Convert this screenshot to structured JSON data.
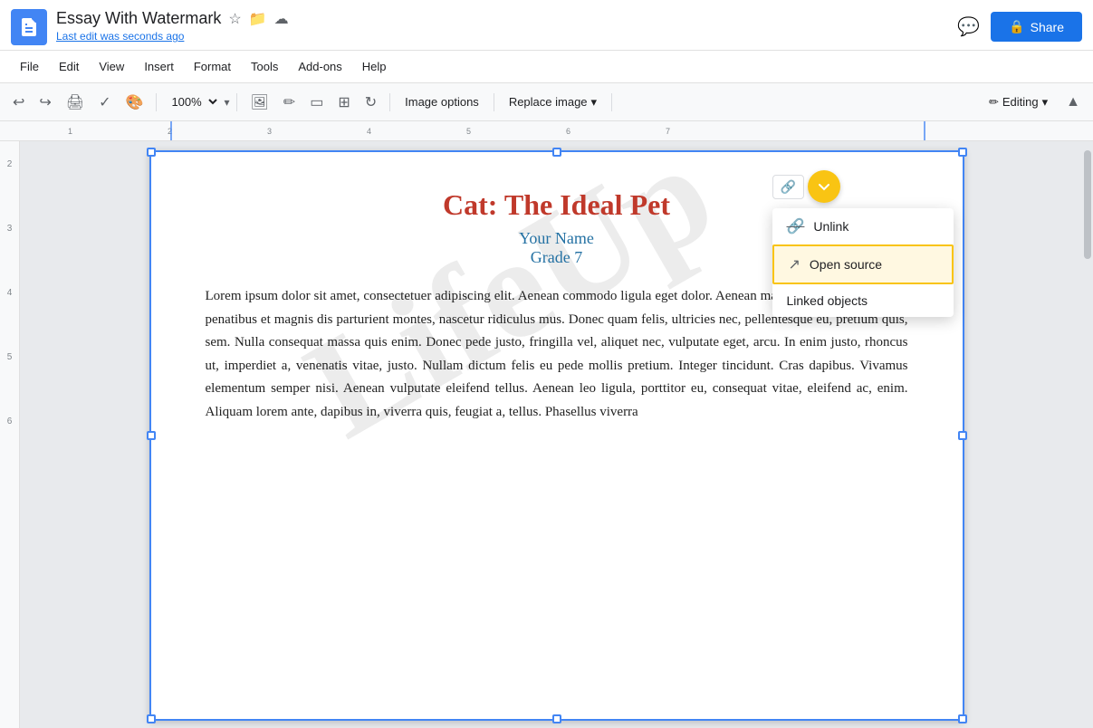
{
  "app": {
    "title": "Essay With Watermark",
    "docs_icon_color": "#4285f4"
  },
  "title_bar": {
    "doc_title": "Essay With Watermark",
    "star_icon": "★",
    "folder_icon": "🗂",
    "cloud_icon": "☁",
    "last_edit": "Last edit was seconds ago",
    "comment_icon": "💬",
    "share_label": "Share",
    "lock_icon": "🔒"
  },
  "menu": {
    "items": [
      "File",
      "Edit",
      "View",
      "Insert",
      "Format",
      "Tools",
      "Add-ons",
      "Help"
    ]
  },
  "toolbar": {
    "undo_icon": "↩",
    "redo_icon": "↪",
    "print_icon": "🖨",
    "paint_icon": "🎨",
    "format_icon": "✏",
    "zoom": "100%",
    "zoom_arrow": "▾",
    "image_options": "Image options",
    "replace_image": "Replace image",
    "replace_arrow": "▾",
    "editing": "Editing",
    "editing_arrow": "▾",
    "collapse_icon": "▲"
  },
  "popup": {
    "link_icon": "🔗",
    "chevron_icon": "▾",
    "unlink_label": "Unlink",
    "open_source_label": "Open source",
    "linked_objects_label": "Linked objects"
  },
  "document": {
    "heading": "Cat: The Ideal Pet",
    "subtitle_line1": "Your Name",
    "subtitle_line2": "Grade 7",
    "watermark": "LifeUp",
    "body": "Lorem ipsum dolor sit amet, consectetuer adipiscing elit. Aenean commodo ligula eget dolor. Aenean massa. Cum sociis natoque penatibus et magnis dis parturient montes, nascetur ridiculus mus. Donec quam felis, ultricies nec, pellentesque eu, pretium quis, sem. Nulla consequat massa quis enim. Donec pede justo, fringilla vel, aliquet nec, vulputate eget, arcu. In enim justo, rhoncus ut, imperdiet a, venenatis vitae, justo. Nullam dictum felis eu pede mollis pretium. Integer tincidunt. Cras dapibus. Vivamus elementum semper nisi. Aenean vulputate eleifend tellus. Aenean leo ligula, porttitor eu, consequat vitae, eleifend ac, enim. Aliquam lorem ante, dapibus in, viverra quis, feugiat a, tellus. Phasellus viverra"
  },
  "ruler": {
    "numbers": [
      1,
      2,
      3,
      4,
      5,
      6,
      7
    ]
  }
}
